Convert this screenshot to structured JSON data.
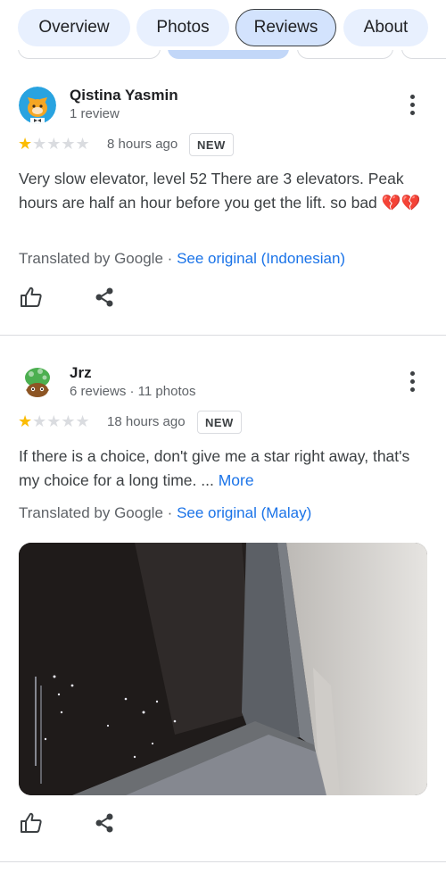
{
  "tabs": [
    {
      "label": "Overview"
    },
    {
      "label": "Photos"
    },
    {
      "label": "Reviews",
      "active": true
    },
    {
      "label": "About"
    }
  ],
  "reviews": [
    {
      "name": "Qistina Yasmin",
      "meta": "1 review",
      "rating": 1,
      "time": "8 hours ago",
      "badge": "NEW",
      "text": "Very slow elevator, level 52 There are 3 elevators. Peak hours are half an hour before you get the lift. so bad",
      "emoji": "💔💔",
      "translated_by": "Translated by Google",
      "separator": "·",
      "see_original": "See original (Indonesian)"
    },
    {
      "name": "Jrz",
      "meta": "6 reviews · 11 photos",
      "rating": 1,
      "time": "18 hours ago",
      "badge": "NEW",
      "text": "If there is a choice, don't give me a star right away, that's my choice for a long time. ...",
      "more": "More",
      "translated_by": "Translated by Google",
      "separator": "·",
      "see_original": "See original (Malay)"
    }
  ],
  "icons": {
    "like": "thumbs-up-icon",
    "share": "share-icon",
    "menu": "more-vert-icon",
    "star": "star-icon"
  },
  "colors": {
    "accent": "#1a73e8",
    "star": "#fbbc04",
    "tab_bg": "#e8f0fe",
    "tab_active_bg": "#d3e3fd"
  }
}
